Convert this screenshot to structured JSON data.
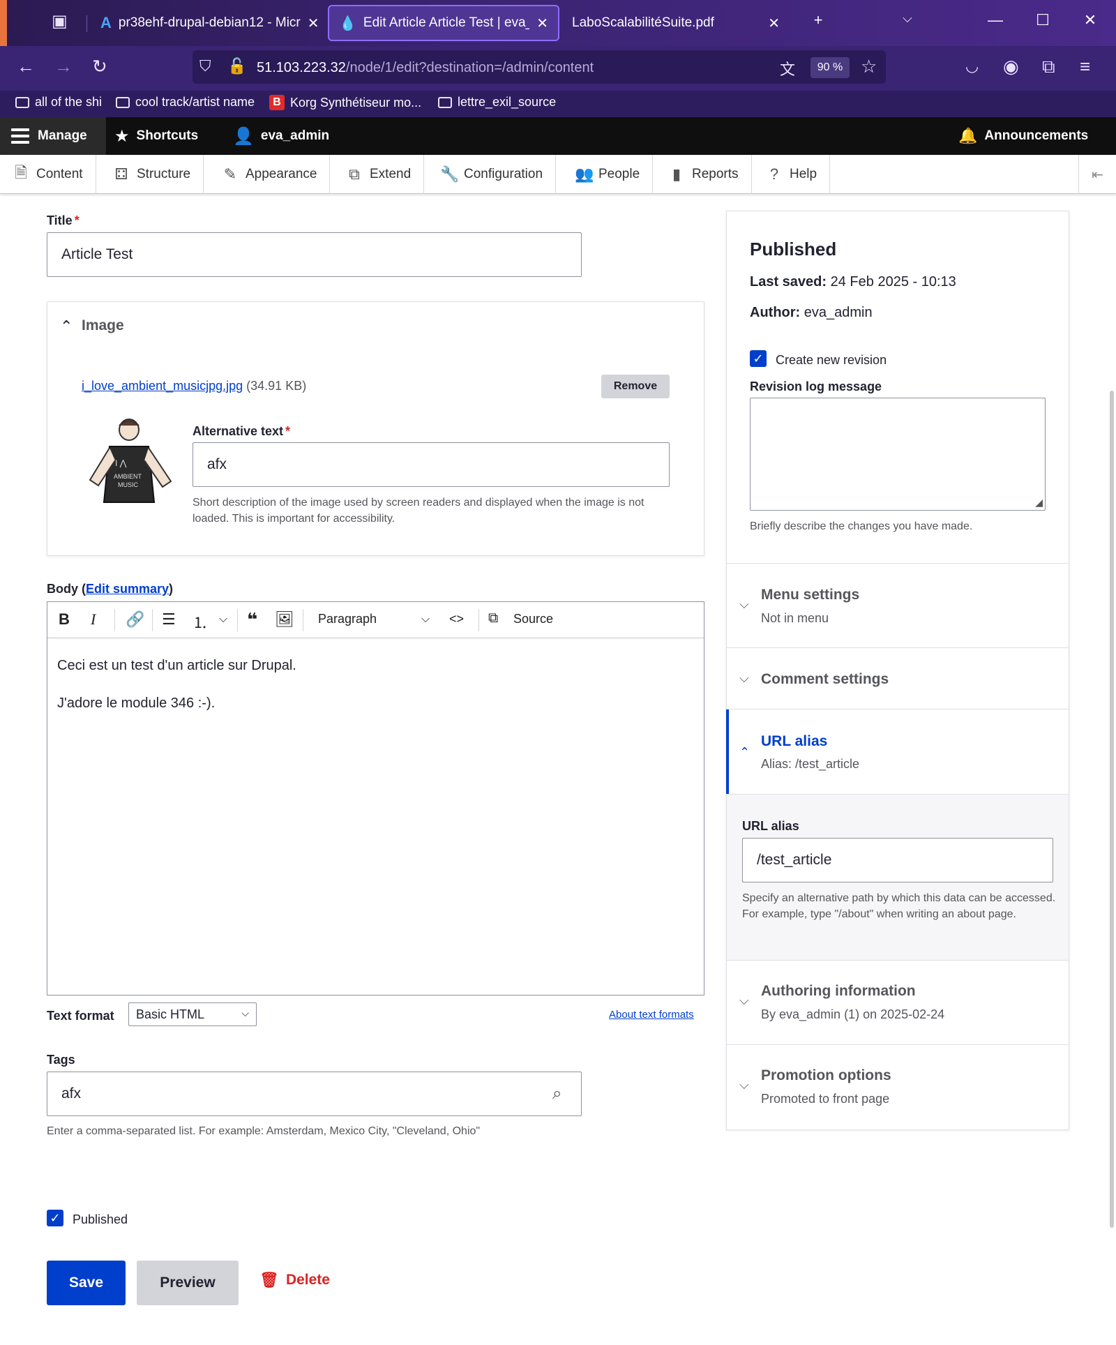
{
  "browser": {
    "tabs": [
      {
        "label": "pr38ehf-drupal-debian12 - Micr"
      },
      {
        "label": "Edit Article Article Test | eva_site"
      },
      {
        "label": "LaboScalabilitéSuite.pdf"
      }
    ],
    "url_host": "51.103.223.32",
    "url_path": "/node/1/edit?destination=/admin/content",
    "zoom": "90 %",
    "bookmarks": [
      {
        "label": "all of the shi"
      },
      {
        "label": "cool track/artist name"
      },
      {
        "label": "Korg Synthétiseur mo..."
      },
      {
        "label": "lettre_exil_source"
      }
    ]
  },
  "toolbar": {
    "manage": "Manage",
    "shortcuts": "Shortcuts",
    "user": "eva_admin",
    "announcements": "Announcements",
    "tray": [
      "Content",
      "Structure",
      "Appearance",
      "Extend",
      "Configuration",
      "People",
      "Reports",
      "Help"
    ]
  },
  "form": {
    "title_label": "Title",
    "title_value": "Article Test",
    "image": {
      "legend": "Image",
      "file_name": "i_love_ambient_musicjpg.jpg",
      "file_size": "(34.91 KB)",
      "remove": "Remove",
      "alt_label": "Alternative text",
      "alt_value": "afx",
      "alt_desc": "Short description of the image used by screen readers and displayed when the image is not loaded. This is important for accessibility."
    },
    "body": {
      "label": "Body",
      "edit_summary": "Edit summary",
      "paragraph": "Paragraph",
      "source": "Source",
      "lines": [
        "Ceci est un test d'un article sur Drupal.",
        "J'adore le module 346 :-)."
      ]
    },
    "text_format_label": "Text format",
    "text_format_value": "Basic HTML",
    "about_formats": "About text formats",
    "tags_label": "Tags",
    "tags_value": "afx",
    "tags_desc": "Enter a comma-separated list. For example: Amsterdam, Mexico City, \"Cleveland, Ohio\"",
    "published": "Published",
    "save": "Save",
    "preview": "Preview",
    "delete": "Delete"
  },
  "sidebar": {
    "status": "Published",
    "last_saved_label": "Last saved:",
    "last_saved_value": "24 Feb 2025 - 10:13",
    "author_label": "Author:",
    "author_value": "eva_admin",
    "new_revision": "Create new revision",
    "revision_label": "Revision log message",
    "revision_desc": "Briefly describe the changes you have made.",
    "menu_title": "Menu settings",
    "menu_summary": "Not in menu",
    "comment_title": "Comment settings",
    "url_title": "URL alias",
    "url_summary": "Alias: /test_article",
    "url_field_label": "URL alias",
    "url_field_value": "/test_article",
    "url_desc": "Specify an alternative path by which this data can be accessed. For example, type \"/about\" when writing an about page.",
    "authoring_title": "Authoring information",
    "authoring_summary": "By eva_admin (1) on 2025-02-24",
    "promotion_title": "Promotion options",
    "promotion_summary": "Promoted to front page"
  },
  "colors": {
    "primary": "#003ecc",
    "danger": "#dc2323",
    "browser_bg": "#3a2474"
  }
}
